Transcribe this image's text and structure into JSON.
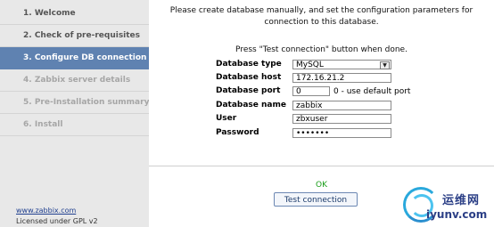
{
  "sidebar": {
    "steps": [
      {
        "label": "1. Welcome"
      },
      {
        "label": "2. Check of pre-requisites"
      },
      {
        "label": "3. Configure DB connection"
      },
      {
        "label": "4. Zabbix server details"
      },
      {
        "label": "5. Pre-Installation summary"
      },
      {
        "label": "6. Install"
      }
    ],
    "link": "www.zabbix.com",
    "license": "Licensed under GPL v2"
  },
  "main": {
    "intro": "Please create database manually, and set the configuration parameters for connection to this database.",
    "hint": "Press \"Test connection\" button when done.",
    "fields": {
      "db_type": {
        "label": "Database type",
        "value": "MySQL"
      },
      "db_host": {
        "label": "Database host",
        "value": "172.16.21.2"
      },
      "db_port": {
        "label": "Database port",
        "value": "0",
        "suffix": "0 - use default port"
      },
      "db_name": {
        "label": "Database name",
        "value": "zabbix"
      },
      "user": {
        "label": "User",
        "value": "zbxuser"
      },
      "password": {
        "label": "Password",
        "value": "•••••••"
      }
    },
    "status": "OK",
    "test_button": "Test connection"
  },
  "watermark": {
    "cn": "运维网",
    "url": "iyunv.com"
  }
}
